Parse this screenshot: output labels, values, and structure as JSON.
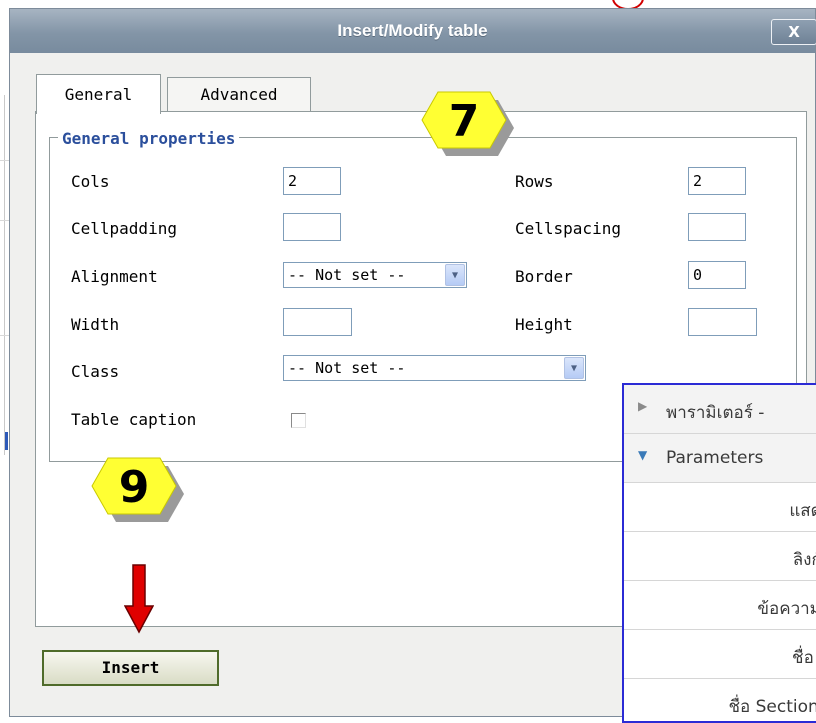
{
  "dialog": {
    "title": "Insert/Modify table",
    "close_label": "X",
    "tabs": [
      {
        "label": "General",
        "active": true
      },
      {
        "label": "Advanced",
        "active": false
      }
    ],
    "legend": "General properties",
    "fields": {
      "cols_label": "Cols",
      "cols_value": "2",
      "rows_label": "Rows",
      "rows_value": "2",
      "cellpadding_label": "Cellpadding",
      "cellpadding_value": "",
      "cellspacing_label": "Cellspacing",
      "cellspacing_value": "",
      "alignment_label": "Alignment",
      "alignment_value": "-- Not set --",
      "border_label": "Border",
      "border_value": "0",
      "width_label": "Width",
      "width_value": "",
      "height_label": "Height",
      "height_value": "",
      "class_label": "Class",
      "class_value": "-- Not set --",
      "caption_label": "Table caption",
      "caption_checked": false
    },
    "insert_label": "Insert"
  },
  "badges": {
    "step7": "7",
    "step9": "9"
  },
  "overlay": {
    "rows": [
      {
        "text": "พารามิเตอร์ -",
        "icon": "triangle-right-icon"
      },
      {
        "text": "Parameters",
        "icon": "triangle-down-icon"
      },
      {
        "text": "แสดง"
      },
      {
        "text": "ลิงก์ใ"
      },
      {
        "text": "ข้อความร"
      },
      {
        "text": "ชื่อ S"
      },
      {
        "text": "ชื่อ Section เ"
      }
    ]
  },
  "colors": {
    "titlebar": "#8395a7",
    "legend": "#2b4f9c",
    "badge_fill": "#ffff33",
    "arrow": "#e00000",
    "overlay_border": "#2b2bd5"
  }
}
